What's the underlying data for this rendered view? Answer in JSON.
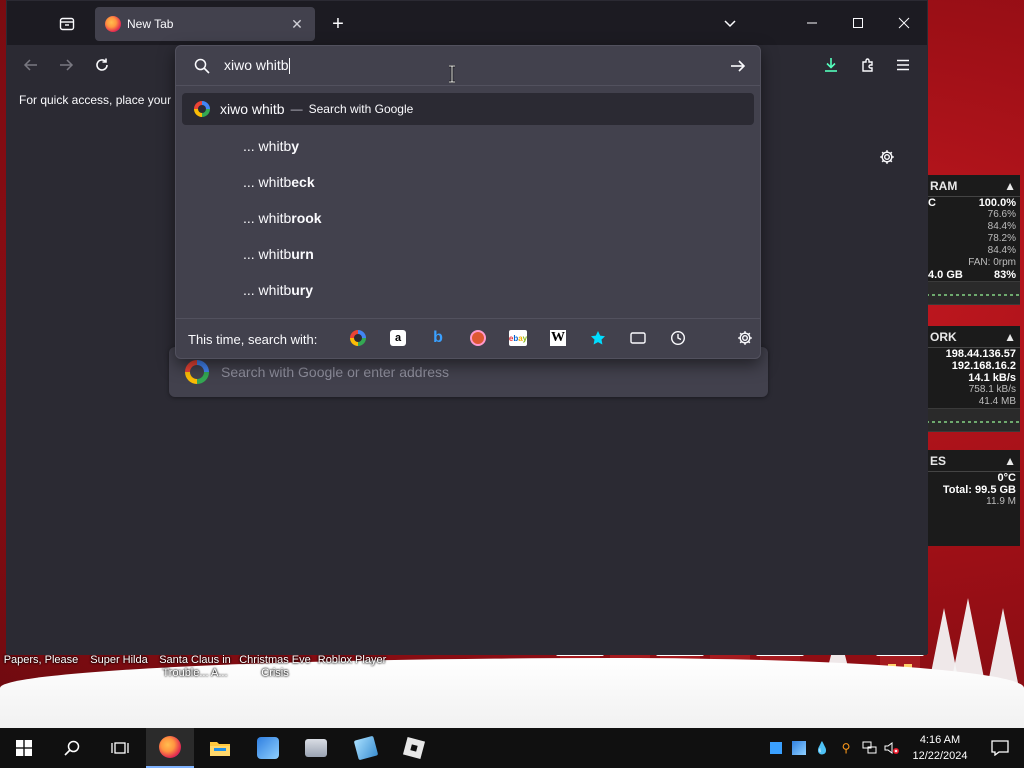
{
  "browser": {
    "tab_title": "New Tab",
    "bookmarks_hint": "For quick access, place your b",
    "url_value": "xiwo whitb",
    "page_search_placeholder": "Search with Google or enter address"
  },
  "suggestions": {
    "top": {
      "query": "xiwo whitb",
      "separator": "—",
      "action": "Search with Google"
    },
    "items": [
      {
        "prefix": "... whitb",
        "completion": "y"
      },
      {
        "prefix": "... whitb",
        "completion": "eck"
      },
      {
        "prefix": "... whitb",
        "completion": "rook"
      },
      {
        "prefix": "... whitb",
        "completion": "urn"
      },
      {
        "prefix": "... whitb",
        "completion": "ury"
      }
    ],
    "one_offs_label": "This time, search with:",
    "engines": [
      "google-icon",
      "amazon-icon",
      "bing-icon",
      "duckduckgo-icon",
      "ebay-icon",
      "wikipedia-icon",
      "bookmarks-icon",
      "tabs-icon",
      "history-icon"
    ]
  },
  "widget": {
    "ram": {
      "title": "RAM",
      "c_label": "C",
      "percent_top": "100.0%",
      "rows": [
        "76.6%",
        "84.4%",
        "78.2%",
        "84.4%"
      ],
      "fan": "FAN: 0rpm",
      "mem": "4.0 GB",
      "mem_pct": "83%"
    },
    "network": {
      "title": "ORK",
      "ip1": "198.44.136.57",
      "ip2": "192.168.16.2",
      "down": "14.1 kB/s",
      "up": "758.1 kB/s",
      "total": "41.4 MB"
    },
    "drives": {
      "title": "ES",
      "temp": "0°C",
      "total": "Total: 99.5 GB",
      "used": "11.9 M"
    }
  },
  "desktop_labels": [
    {
      "text": "Papers, Please"
    },
    {
      "text": "Super Hilda"
    },
    {
      "text": "Santa Claus in Trouble... A..."
    },
    {
      "text": "Christmas Eve Crisis"
    },
    {
      "text": "Roblox Player"
    }
  ],
  "taskbar": {
    "time": "4:16 AM",
    "date": "12/22/2024"
  },
  "colors": {
    "accent": "#0df",
    "download": "#54ffbd"
  }
}
